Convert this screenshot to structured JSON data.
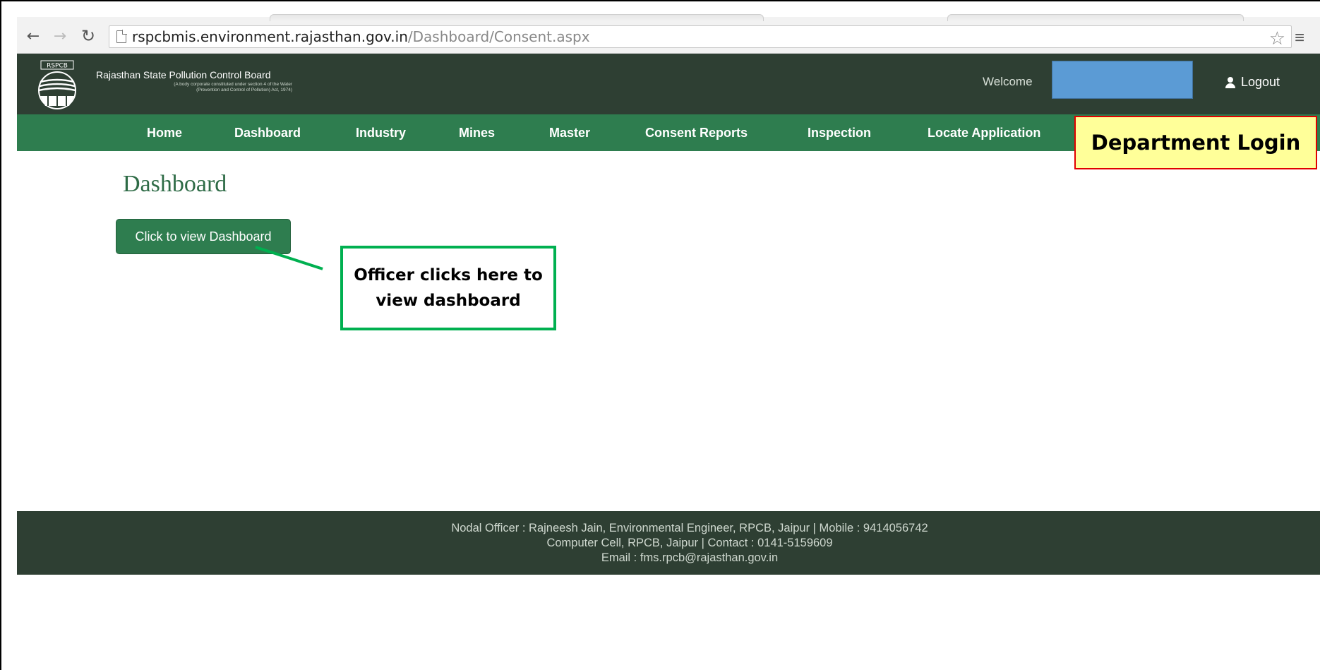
{
  "browser": {
    "url_host": "rspcbmis.environment.rajasthan.gov.in",
    "url_path": "/Dashboard/Consent.aspx"
  },
  "header": {
    "logo_text": "RSPCB",
    "board_name": "Rajasthan State Pollution Control Board",
    "board_sub_line1": "(A body corporate constituted under section 4 of the Water",
    "board_sub_line2": "(Prevention and Control of Pollution) Act, 1974)",
    "welcome": "Welcome",
    "logout": "Logout",
    "user_box_color": "#5b9bd5"
  },
  "nav": {
    "items": [
      {
        "label": "Home"
      },
      {
        "label": "Dashboard"
      },
      {
        "label": "Industry"
      },
      {
        "label": "Mines"
      },
      {
        "label": "Master"
      },
      {
        "label": "Consent Reports"
      },
      {
        "label": "Inspection"
      },
      {
        "label": "Locate Application"
      }
    ]
  },
  "annotation": {
    "department_login": "Department Login",
    "callout": "Officer clicks here to view dashboard"
  },
  "main": {
    "title": "Dashboard",
    "view_button": "Click to view Dashboard"
  },
  "footer": {
    "line1": "Nodal Officer : Rajneesh Jain, Environmental Engineer, RPCB, Jaipur | Mobile : 9414056742",
    "line2": "Computer Cell, RPCB, Jaipur | Contact : 0141-5159609",
    "line3": "Email : fms.rpcb@rajasthan.gov.in"
  },
  "colors": {
    "header_bg": "#2e3f33",
    "nav_bg": "#2e7d4f",
    "callout_border": "#00b050",
    "dept_login_bg": "#ffff99",
    "dept_login_border": "#e00000"
  }
}
